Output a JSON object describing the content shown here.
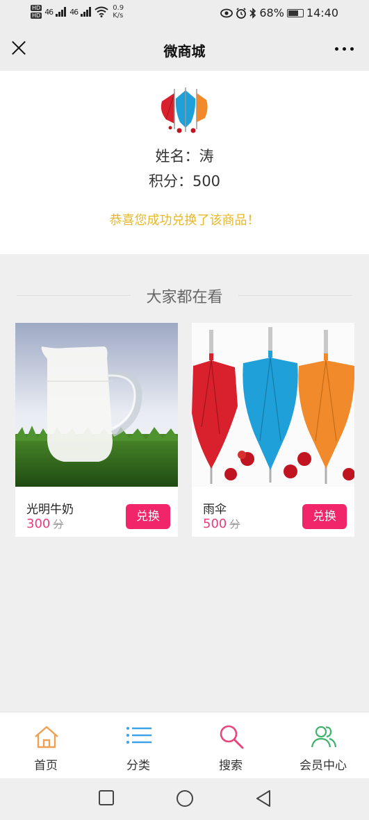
{
  "status_bar": {
    "hd1": "HD",
    "hd2": "HD",
    "signal1": "46",
    "signal2": "46",
    "speed_value": "0.9",
    "speed_unit": "K/s",
    "battery": "68%",
    "time": "14:40"
  },
  "nav": {
    "title": "微商城"
  },
  "profile": {
    "name": "姓名：涛",
    "points": "积分：500",
    "message": "恭喜您成功兑换了该商品！"
  },
  "section": {
    "title": "大家都在看"
  },
  "products": [
    {
      "name": "光明牛奶",
      "price": "300",
      "unit": "分",
      "button": "兑换"
    },
    {
      "name": "雨伞",
      "price": "500",
      "unit": "分",
      "button": "兑换"
    }
  ],
  "tabbar": {
    "items": [
      {
        "label": "首页",
        "icon": "home-icon",
        "color": "#f0a050"
      },
      {
        "label": "分类",
        "icon": "list-icon",
        "color": "#3ba3e8"
      },
      {
        "label": "搜索",
        "icon": "search-icon",
        "color": "#e8457a"
      },
      {
        "label": "会员中心",
        "icon": "members-icon",
        "color": "#3fb26a"
      }
    ]
  },
  "colors": {
    "accent": "#f0256a",
    "message": "#e8b824",
    "price": "#e83c7e"
  }
}
